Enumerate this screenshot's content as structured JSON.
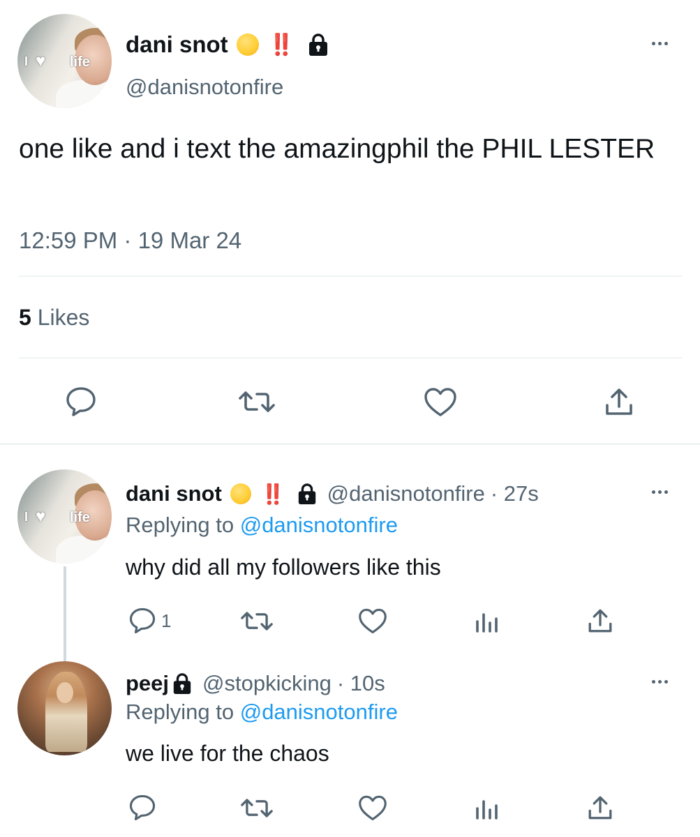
{
  "main_tweet": {
    "display_name": "dani snot",
    "bang": "‼️",
    "handle": "@danisnotonfire",
    "avatar_sticker_i": "I",
    "avatar_sticker_life": "life",
    "text": "one like and i text the amazingphil the PHIL LESTER",
    "timestamp": "12:59 PM · 19 Mar 24",
    "likes_count": "5",
    "likes_label": "Likes"
  },
  "reply1": {
    "display_name": "dani snot",
    "bang": "‼️",
    "handle": "@danisnotonfire",
    "time": "· 27s",
    "replying_prefix": "Replying to",
    "replying_handle": "@danisnotonfire",
    "avatar_sticker_i": "I",
    "avatar_sticker_life": "life",
    "text": "why did all my followers like this",
    "reply_count": "1"
  },
  "reply2": {
    "display_name": "peej",
    "handle": "@stopkicking",
    "time": "· 10s",
    "replying_prefix": "Replying to",
    "replying_handle": "@danisnotonfire",
    "text": "we live for the chaos"
  },
  "colors": {
    "accent": "#1d9bf0",
    "muted": "#536471",
    "divider": "#eff3f4",
    "bang": "#e0243a"
  },
  "icons": [
    "reply-icon",
    "retweet-icon",
    "like-icon",
    "share-icon",
    "analytics-icon",
    "lock-icon",
    "more-icon"
  ]
}
